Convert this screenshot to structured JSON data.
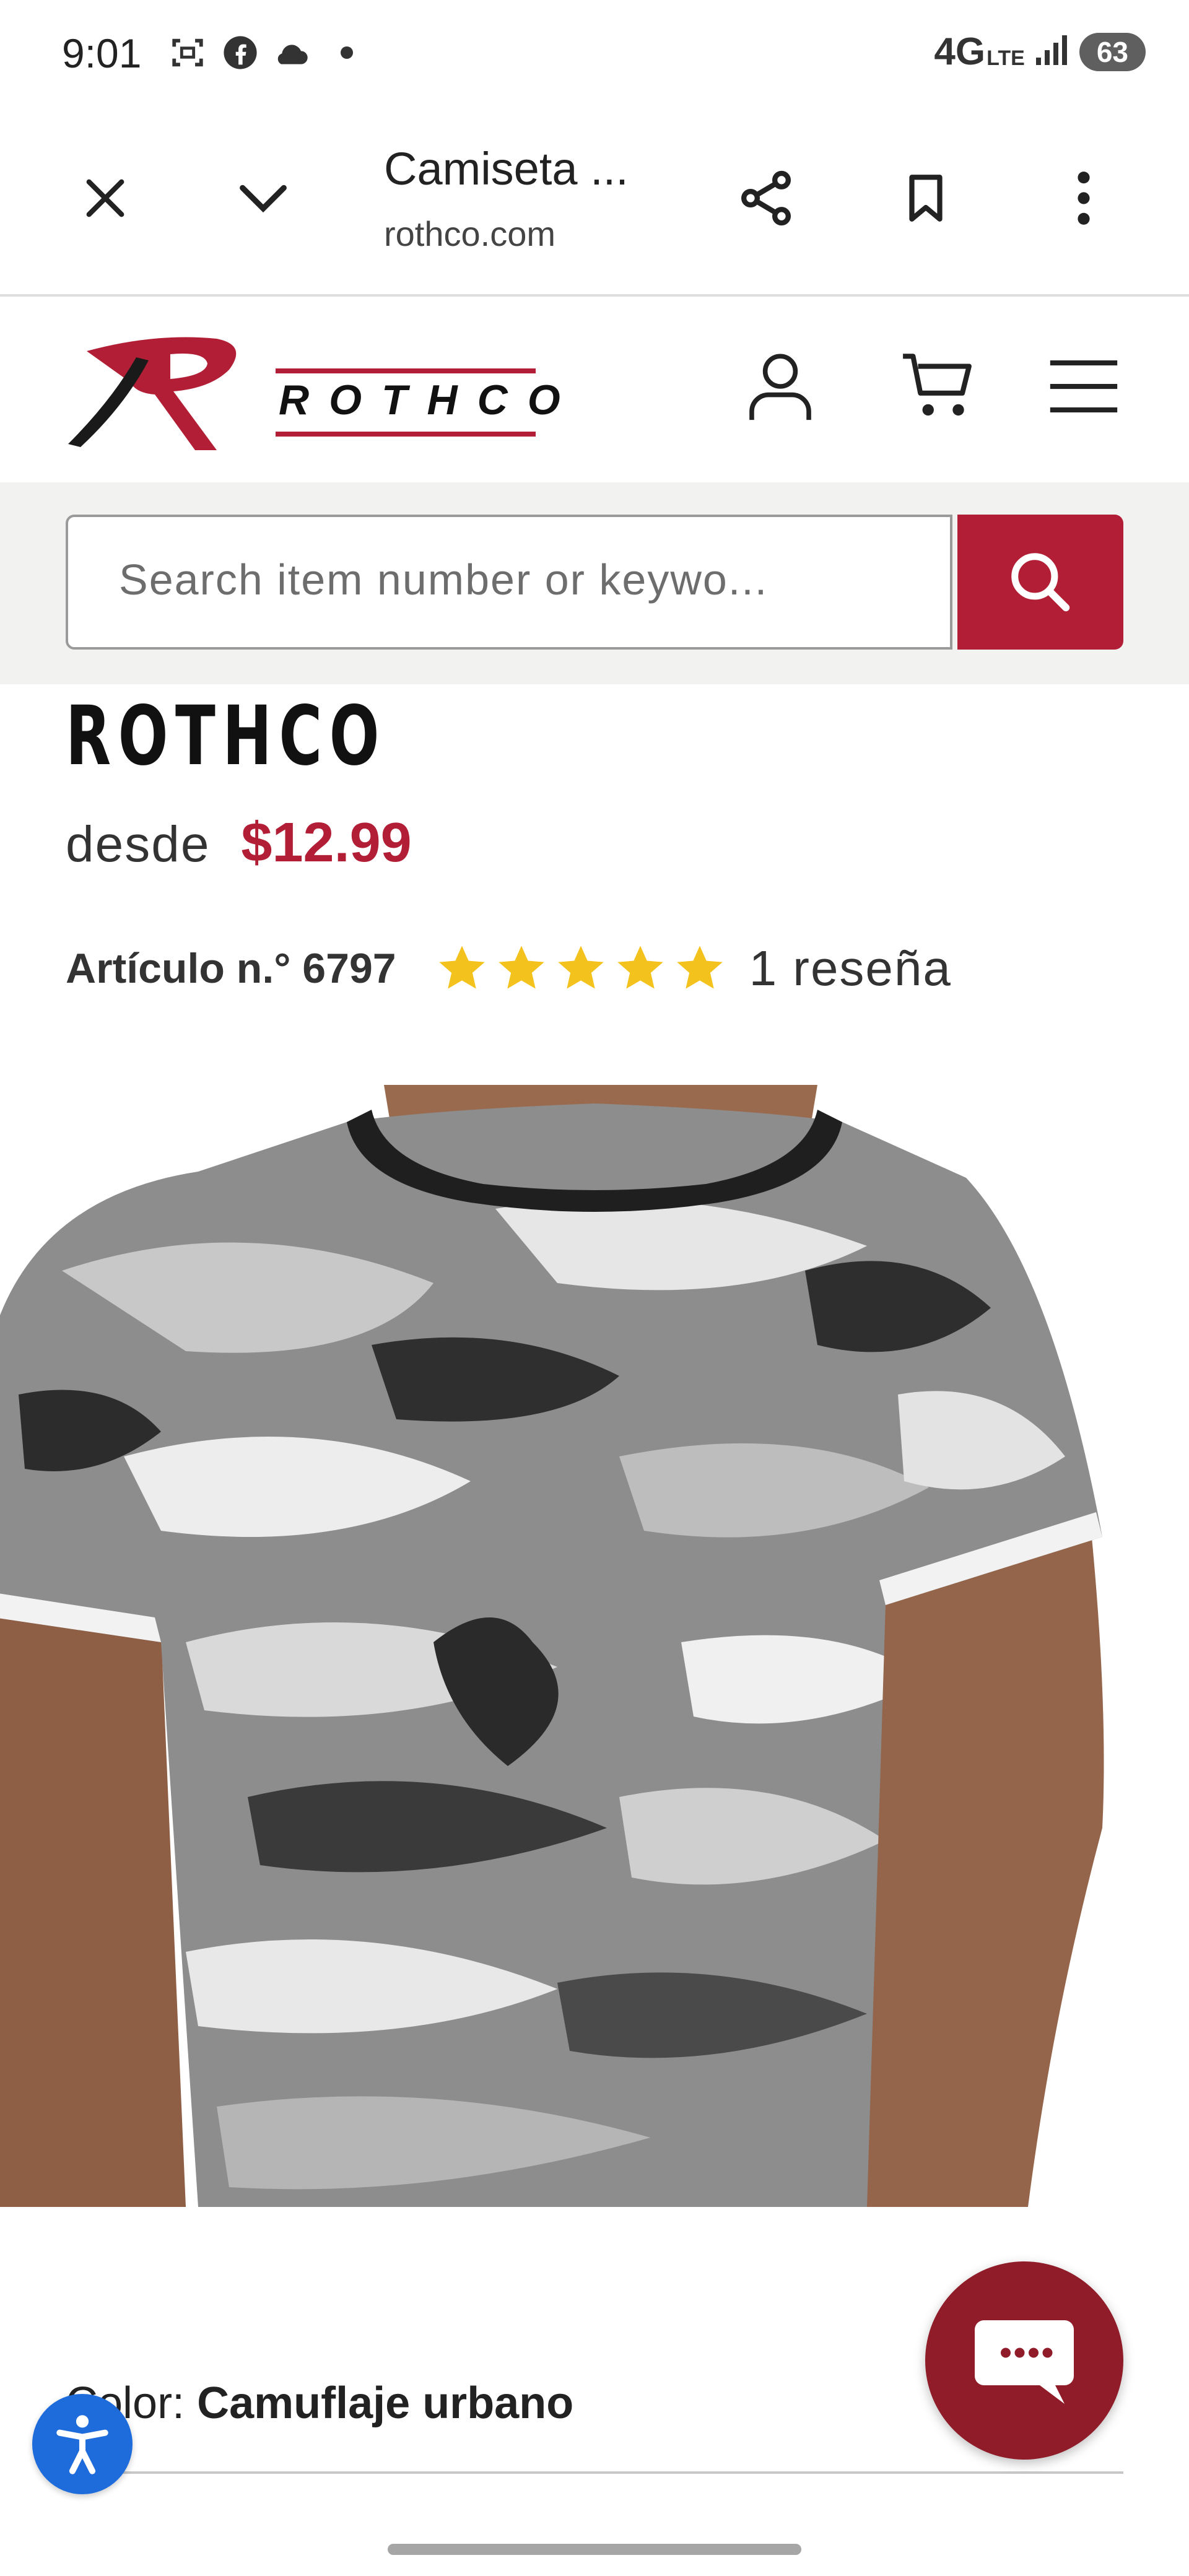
{
  "status_bar": {
    "time": "9:01",
    "icons": [
      "screenshot-icon",
      "facebook-icon",
      "cloud-icon",
      "dot-icon"
    ],
    "network": "4G",
    "network_sub": "LTE",
    "battery": "63"
  },
  "browser": {
    "tab_title": "Camiseta ...",
    "url": "rothco.com"
  },
  "site": {
    "logo_text": "ROTHCO",
    "brand_color": "#b21e35"
  },
  "search": {
    "placeholder": "Search item number or keywo..."
  },
  "product": {
    "brand": "ROTHCO",
    "price_prefix": "desde",
    "price": "$12.99",
    "sku": "Artículo n.° 6797",
    "rating": 5,
    "rating_max": 5,
    "review_count": "1 reseña",
    "color_label": "Color:",
    "color_value": "Camuflaje urbano"
  },
  "colors": {
    "accent": "#b21e35",
    "star": "#f4c21c",
    "chat": "#8f1c28",
    "accessibility": "#1e6cdc"
  }
}
